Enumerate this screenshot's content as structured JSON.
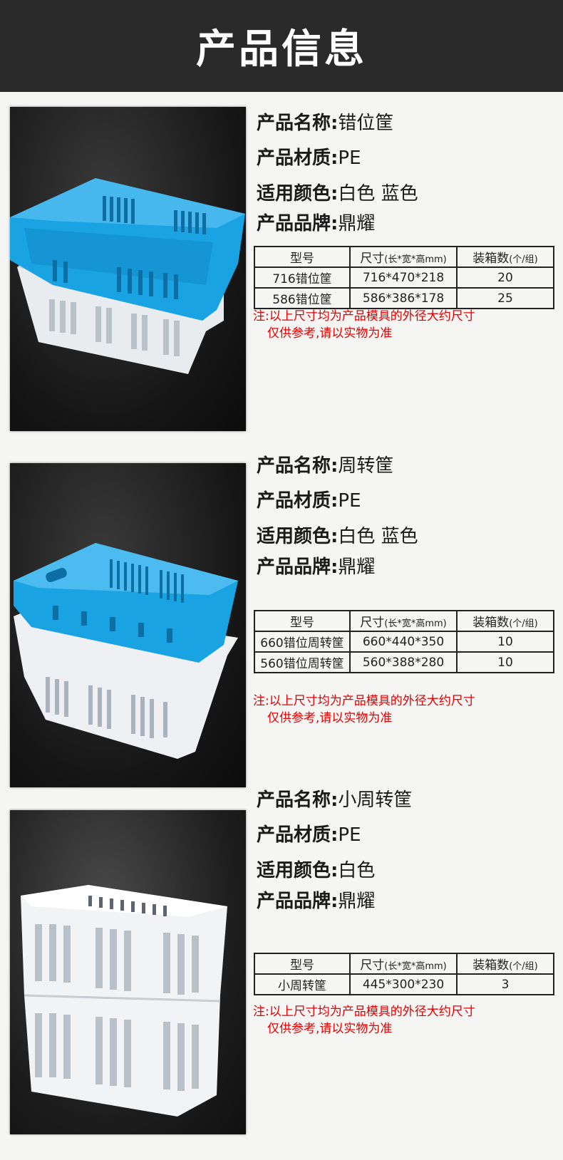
{
  "header": {
    "title": "产品信息"
  },
  "labels": {
    "name": "产品名称:",
    "material": "产品材质:",
    "color": "适用颜色:",
    "brand": "产品品牌:"
  },
  "table_headers": {
    "model": "型号",
    "size": "尺寸",
    "size_unit": "(长*宽*高mm)",
    "qty": "装箱数",
    "qty_unit": "(个/组)"
  },
  "note": {
    "line1": "注:以上尺寸均为产品模具的外径大约尺寸",
    "line2": "仅供参考,请以实物为准"
  },
  "products": [
    {
      "name": "错位筐",
      "material": "PE",
      "color": "白色 蓝色",
      "brand": "鼎耀",
      "rows": [
        {
          "model": "716错位筐",
          "size": "716*470*218",
          "qty": "20"
        },
        {
          "model": "586错位筐",
          "size": "586*386*178",
          "qty": "25"
        }
      ]
    },
    {
      "name": "周转筐",
      "material": "PE",
      "color": "白色 蓝色",
      "brand": "鼎耀",
      "rows": [
        {
          "model": "660错位周转筐",
          "size": "660*440*350",
          "qty": "10"
        },
        {
          "model": "560错位周转筐",
          "size": "560*388*280",
          "qty": "10"
        }
      ]
    },
    {
      "name": "小周转筐",
      "material": "PE",
      "color": "白色",
      "brand": "鼎耀",
      "rows": [
        {
          "model": "小周转筐",
          "size": "445*300*230",
          "qty": "3"
        }
      ]
    }
  ],
  "colors": {
    "header_bg": "#2a2a2a",
    "note": "#e60000",
    "crate_blue": "#1aa3e3",
    "crate_white": "#eef0f3"
  }
}
